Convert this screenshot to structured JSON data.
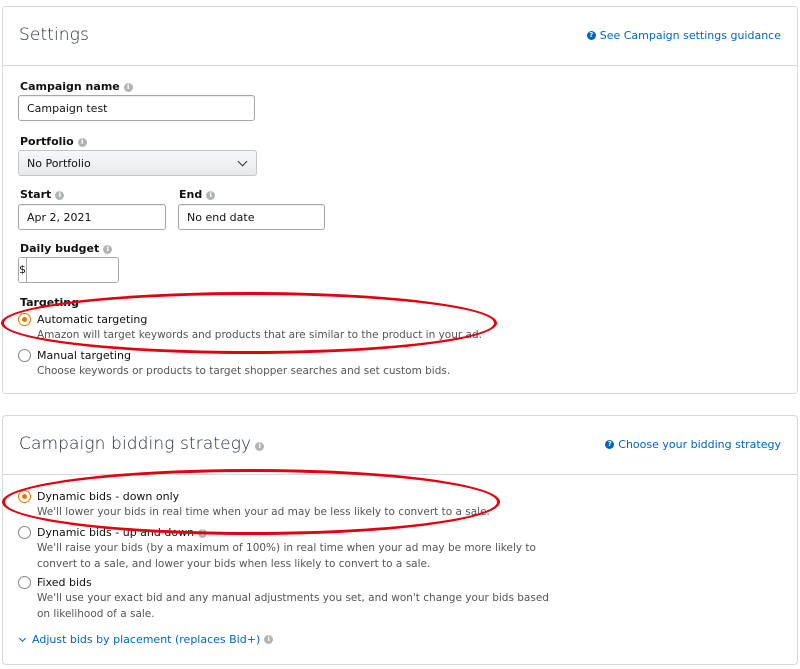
{
  "settings": {
    "title": "Settings",
    "guidance_link": "See Campaign settings guidance",
    "campaign_name": {
      "label": "Campaign name",
      "value": "Campaign test"
    },
    "portfolio": {
      "label": "Portfolio",
      "value": "No Portfolio"
    },
    "start": {
      "label": "Start",
      "value": "Apr 2, 2021"
    },
    "end": {
      "label": "End",
      "value": "No end date"
    },
    "daily_budget": {
      "label": "Daily budget",
      "currency": "$",
      "value": ""
    },
    "targeting": {
      "label": "Targeting",
      "options": [
        {
          "label": "Automatic targeting",
          "description": "Amazon will target keywords and products that are similar to the product in your ad.",
          "selected": true
        },
        {
          "label": "Manual targeting",
          "description": "Choose keywords or products to target shopper searches and set custom bids.",
          "selected": false
        }
      ]
    }
  },
  "bidding": {
    "title": "Campaign bidding strategy",
    "guidance_link": "Choose your bidding strategy",
    "options": [
      {
        "label": "Dynamic bids - down only",
        "description": "We'll lower your bids in real time when your ad may be less likely to convert to a sale.",
        "selected": true
      },
      {
        "label": "Dynamic bids - up and down",
        "description_line1": "We'll raise your bids (by a maximum of 100%) in real time when your ad may be more likely to",
        "description_line2": "convert to a sale, and lower your bids when less likely to convert to a sale.",
        "selected": false
      },
      {
        "label": "Fixed bids",
        "description_line1": "We'll use your exact bid and any manual adjustments you set, and won't change your bids based",
        "description_line2": "on likelihood of a sale.",
        "selected": false
      }
    ],
    "adjust_link": "Adjust bids by placement (replaces Bid+)"
  },
  "icons": {
    "info": "i",
    "help": "?"
  },
  "colors": {
    "accent": "#e77600",
    "link": "#0066c0",
    "annotation": "#e3000f"
  }
}
